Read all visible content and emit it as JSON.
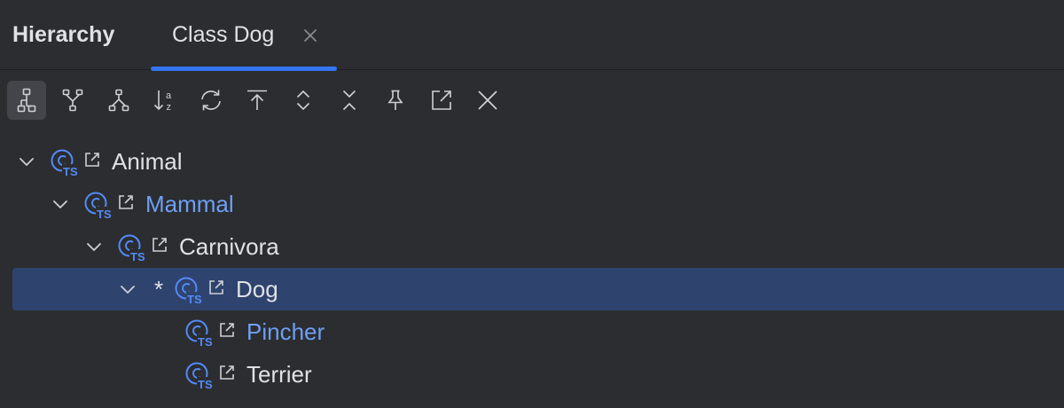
{
  "header": {
    "title": "Hierarchy",
    "tabs": [
      {
        "label": "Class Dog",
        "active": true
      }
    ]
  },
  "toolbar": {
    "buttons": [
      {
        "icon": "class-hierarchy-icon",
        "active": true
      },
      {
        "icon": "supertypes-hierarchy-icon"
      },
      {
        "icon": "subtypes-hierarchy-icon"
      },
      {
        "icon": "sort-alphabetically-icon"
      },
      {
        "icon": "refresh-icon"
      },
      {
        "icon": "scope-base-icon"
      },
      {
        "icon": "expand-all-icon"
      },
      {
        "icon": "collapse-all-icon"
      },
      {
        "icon": "pin-icon"
      },
      {
        "icon": "open-in-new-tab-icon"
      },
      {
        "icon": "close-icon"
      }
    ]
  },
  "tree": {
    "nodes": [
      {
        "label": "Animal",
        "level": 0,
        "expanded": true,
        "color": "default"
      },
      {
        "label": "Mammal",
        "level": 1,
        "expanded": true,
        "color": "blue"
      },
      {
        "label": "Carnivora",
        "level": 2,
        "expanded": true,
        "color": "default"
      },
      {
        "label": "Dog",
        "level": 3,
        "expanded": true,
        "selected": true,
        "marker": "*",
        "color": "default"
      },
      {
        "label": "Pincher",
        "level": 4,
        "color": "blue"
      },
      {
        "label": "Terrier",
        "level": 4,
        "color": "default"
      }
    ],
    "icon_badge": "TS"
  },
  "colors": {
    "background": "#2b2d30",
    "accent": "#3574f0",
    "selection": "#2e436e",
    "link_blue": "#6f9ff3",
    "text": "#dfe1e5"
  }
}
